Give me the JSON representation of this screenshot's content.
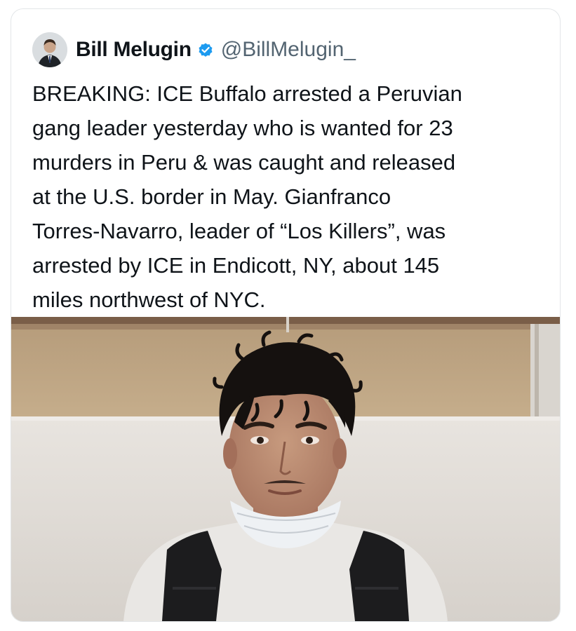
{
  "author": {
    "display_name": "Bill Melugin",
    "handle": "@BillMelugin_",
    "verified_icon": "verified-badge-icon",
    "avatar_icon": "profile-avatar-icon"
  },
  "tweet": {
    "text": "BREAKING: ICE Buffalo arrested a Peruvian\ngang leader yesterday who is wanted for 23\nmurders in Peru & was caught and released\nat the U.S. border in May. Gianfranco\nTorres-Navarro, leader of “Los Killers”, was\narrested by ICE in Endicott, NY, about 145\nmiles northwest of NYC."
  },
  "colors": {
    "text_primary": "#0f1419",
    "text_secondary": "#536471",
    "verified_blue": "#1d9bf0",
    "card_border": "#e3e6e8"
  }
}
